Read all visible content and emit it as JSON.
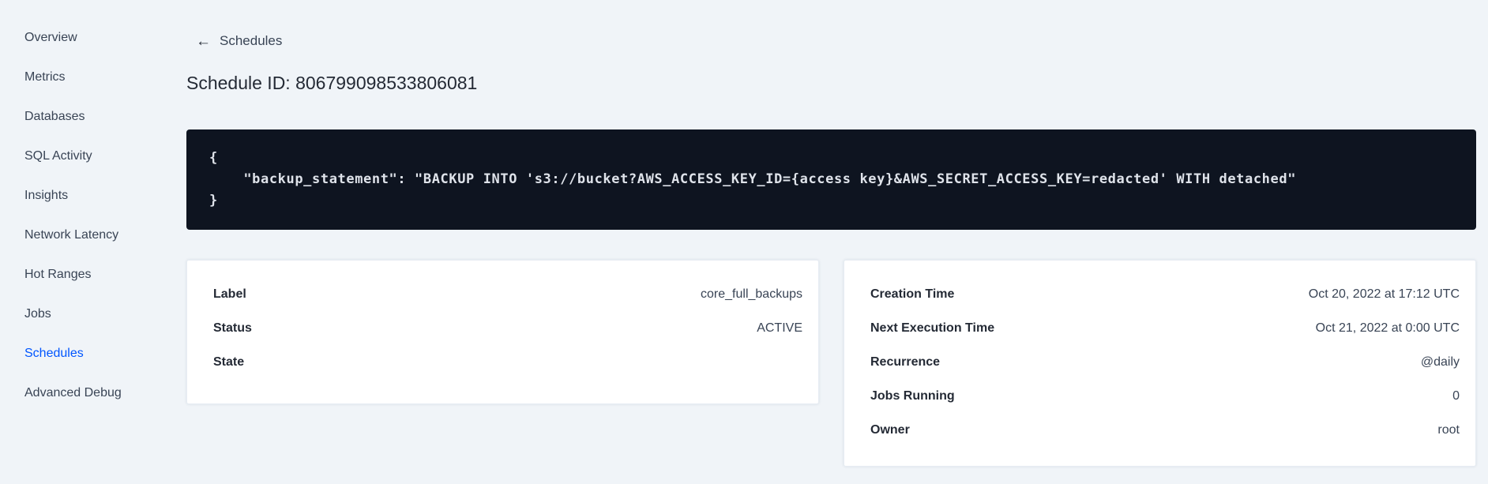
{
  "sidebar": {
    "items": [
      {
        "label": "Overview",
        "active": false
      },
      {
        "label": "Metrics",
        "active": false
      },
      {
        "label": "Databases",
        "active": false
      },
      {
        "label": "SQL Activity",
        "active": false
      },
      {
        "label": "Insights",
        "active": false
      },
      {
        "label": "Network Latency",
        "active": false
      },
      {
        "label": "Hot Ranges",
        "active": false
      },
      {
        "label": "Jobs",
        "active": false
      },
      {
        "label": "Schedules",
        "active": true
      },
      {
        "label": "Advanced Debug",
        "active": false
      }
    ]
  },
  "header": {
    "back_icon": "←",
    "back_label": "Schedules",
    "title": "Schedule ID: 806799098533806081"
  },
  "code_block": {
    "lines": [
      "{",
      "    \"backup_statement\": \"BACKUP INTO 's3://bucket?AWS_ACCESS_KEY_ID={access key}&AWS_SECRET_ACCESS_KEY=redacted' WITH detached\"",
      "}"
    ]
  },
  "cards": {
    "left": {
      "rows": [
        {
          "label": "Label",
          "value": "core_full_backups"
        },
        {
          "label": "Status",
          "value": "ACTIVE"
        },
        {
          "label": "State",
          "value": ""
        }
      ]
    },
    "right": {
      "rows": [
        {
          "label": "Creation Time",
          "value": "Oct 20, 2022 at 17:12 UTC"
        },
        {
          "label": "Next Execution Time",
          "value": "Oct 21, 2022 at 0:00 UTC"
        },
        {
          "label": "Recurrence",
          "value": "@daily"
        },
        {
          "label": "Jobs Running",
          "value": "0"
        },
        {
          "label": "Owner",
          "value": "root"
        }
      ]
    }
  },
  "colors": {
    "accent_blue": "#0055ff",
    "page_background": "#f0f4f8",
    "code_background": "#0e1420",
    "code_text": "#dfe3ea",
    "body_text": "#394455",
    "heading_text": "#242a35",
    "card_border": "#e7ecf3"
  }
}
